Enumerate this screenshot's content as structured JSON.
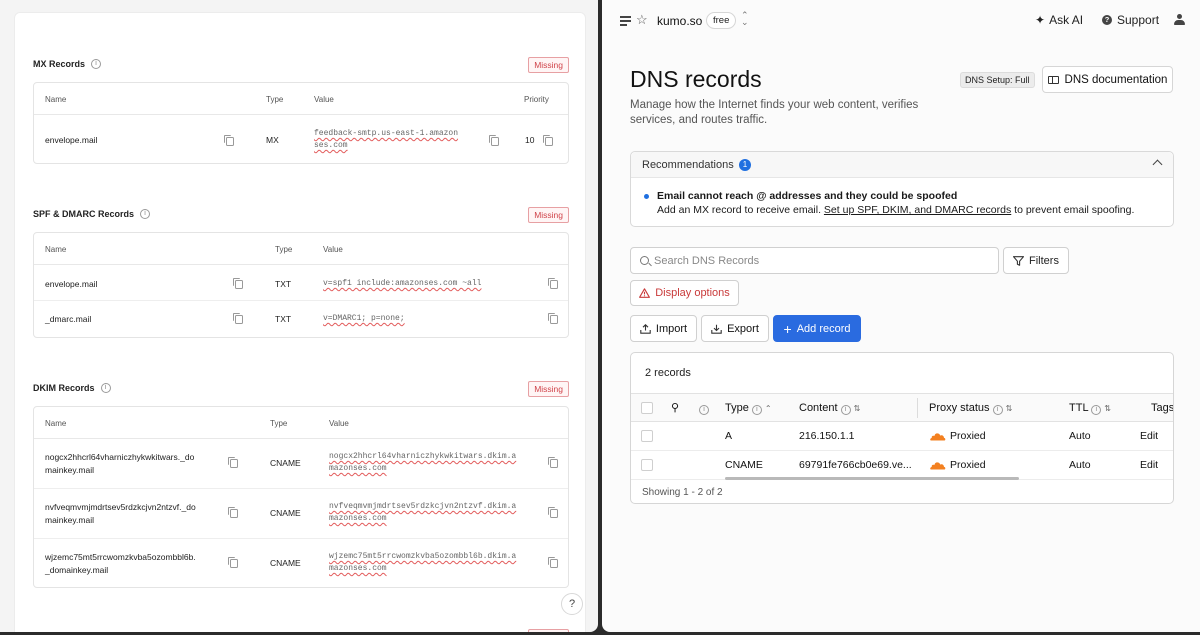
{
  "left": {
    "mx": {
      "title": "MX Records",
      "status": "Missing",
      "headers": {
        "name": "Name",
        "type": "Type",
        "value": "Value",
        "priority": "Priority"
      },
      "rows": [
        {
          "name": "envelope.mail",
          "type": "MX",
          "value_line1": "feedback-smtp.us-east-1.amazon",
          "value_line2": "ses.com",
          "priority": "10"
        }
      ]
    },
    "spf": {
      "title": "SPF & DMARC Records",
      "status": "Missing",
      "headers": {
        "name": "Name",
        "type": "Type",
        "value": "Value"
      },
      "rows": [
        {
          "name": "envelope.mail",
          "type": "TXT",
          "value": "v=spf1 include:amazonses.com ~all"
        },
        {
          "name": "_dmarc.mail",
          "type": "TXT",
          "value": "v=DMARC1; p=none;"
        }
      ]
    },
    "dkim": {
      "title": "DKIM Records",
      "status": "Missing",
      "headers": {
        "name": "Name",
        "type": "Type",
        "value": "Value"
      },
      "rows": [
        {
          "name_line1": "nogcx2hhcrl64vharniczhykwkitwars._do",
          "name_line2": "mainkey.mail",
          "type": "CNAME",
          "value_line1": "nogcx2hhcrl64vharniczhykwkitwars.dkim.a",
          "value_line2": "mazonses.com"
        },
        {
          "name_line1": "nvfveqmvmjmdrtsev5rdzkcjvn2ntzvf._do",
          "name_line2": "mainkey.mail",
          "type": "CNAME",
          "value_line1": "nvfveqmvmjmdrtsev5rdzkcjvn2ntzvf.dkim.a",
          "value_line2": "mazonses.com"
        },
        {
          "name_line1": "wjzemc75mt5rrcwomzkvba5ozombbl6b.",
          "name_line2": "_domainkey.mail",
          "type": "CNAME",
          "value_line1": "wjzemc75mt5rrcwomzkvba5ozombbl6b.dkim.a",
          "value_line2": "mazonses.com"
        }
      ]
    },
    "help": "?"
  },
  "right": {
    "topbar": {
      "account": "kumo.so",
      "plan": "free",
      "ask_ai": "Ask AI",
      "support": "Support"
    },
    "title": "DNS records",
    "setup_badge": "DNS Setup: Full",
    "doc_button": "DNS documentation",
    "subtitle": "Manage how the Internet finds your web content, verifies services, and routes traffic.",
    "recommendations": {
      "title": "Recommendations",
      "count": "1",
      "heading": "Email cannot reach @ addresses and they could be spoofed",
      "text_before": "Add an MX record to receive email. ",
      "link": "Set up SPF, DKIM, and DMARC records",
      "text_after": " to prevent email spoofing."
    },
    "search_placeholder": "Search DNS Records",
    "filters": "Filters",
    "display_options": "Display options",
    "import": "Import",
    "export": "Export",
    "add_record": "Add record",
    "records": {
      "count_label": "2 records",
      "headers": {
        "type": "Type",
        "content": "Content",
        "proxy": "Proxy status",
        "ttl": "TTL",
        "tags": "Tags"
      },
      "rows": [
        {
          "type": "A",
          "content": "216.150.1.1",
          "proxy": "Proxied",
          "ttl": "Auto",
          "action": "Edit"
        },
        {
          "type": "CNAME",
          "content": "69791fe766cb0e69.ve...",
          "proxy": "Proxied",
          "ttl": "Auto",
          "action": "Edit"
        }
      ],
      "footer": "Showing 1 - 2 of 2"
    },
    "colors": {
      "accent": "#2a6be0",
      "danger": "#c93a3a",
      "cloud": "#f38020"
    }
  }
}
